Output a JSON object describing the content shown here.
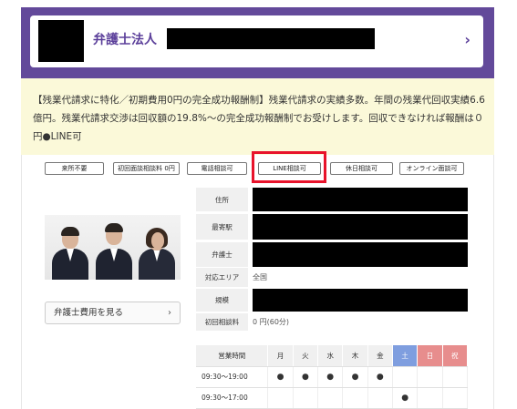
{
  "header": {
    "firm_prefix": "弁護士法人",
    "chevron": "›"
  },
  "description": "【残業代請求に特化／初期費用0円の完全成功報酬制】残業代請求の実績多数。年間の残業代回収実績6.6億円。残業代請求交渉は回収額の19.8%～の完全成功報酬制でお受けします。回収できなければ報酬は０円●LINE可",
  "tags": [
    "来所不要",
    "初回面談相談料 0円",
    "電話相談可",
    "LINE相談可",
    "休日相談可",
    "オンライン面談可"
  ],
  "fee_button": {
    "label": "弁護士費用を見る",
    "arrow": "›"
  },
  "info": {
    "address_label": "住所",
    "station_label": "最寄駅",
    "lawyer_label": "弁護士",
    "area_label": "対応エリア",
    "area_value": "全国",
    "scale_label": "規模",
    "first_fee_label": "初回相談料",
    "first_fee_value": "0 円(60分)"
  },
  "schedule": {
    "header": [
      "営業時間",
      "月",
      "火",
      "水",
      "木",
      "金",
      "土",
      "日",
      "祝"
    ],
    "rows": [
      {
        "hours": "09:30～19:00",
        "marks": [
          "●",
          "●",
          "●",
          "●",
          "●",
          "",
          "",
          ""
        ]
      },
      {
        "hours": "09:30～17:00",
        "marks": [
          "",
          "",
          "",
          "",
          "",
          "●",
          "",
          ""
        ]
      }
    ]
  },
  "colors": {
    "brand": "#63499a",
    "highlight": "#e8132b",
    "desc_bg": "#fbf9d9",
    "saturday": "#7f9edf",
    "sunday": "#e78d8d"
  }
}
